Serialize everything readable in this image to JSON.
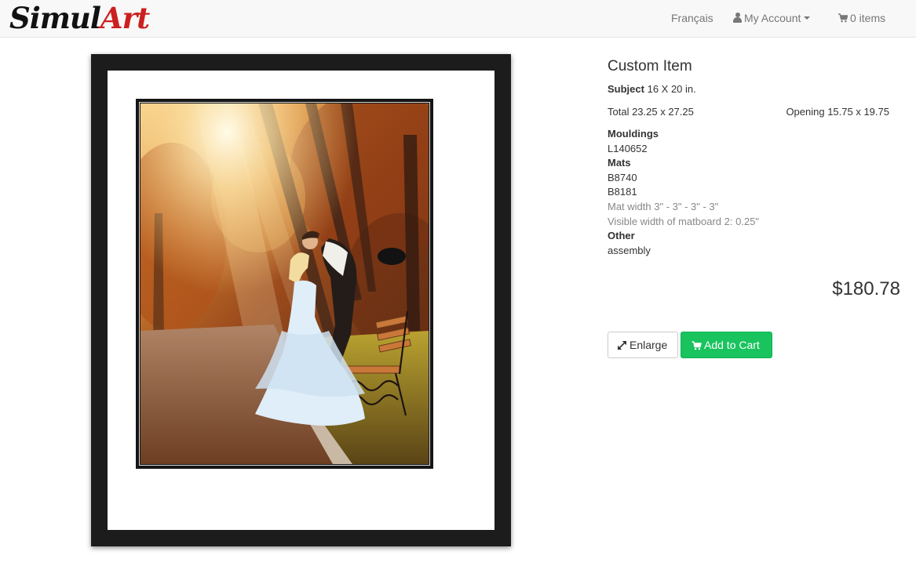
{
  "navbar": {
    "logo_part1": "Simul",
    "logo_part2": "Art",
    "language": "Français",
    "account": "My Account",
    "cart": "0 items"
  },
  "product": {
    "title": "Custom Item",
    "subject_label": "Subject",
    "subject_value": "16 X 20 in.",
    "total": "Total 23.25 x 27.25",
    "opening": "Opening 15.75 x 19.75",
    "mouldings_label": "Mouldings",
    "mouldings": [
      "L140652"
    ],
    "mats_label": "Mats",
    "mats": [
      "B8740",
      "B8181"
    ],
    "mat_width": "Mat width 3\" - 3\" - 3\" - 3\"",
    "visible_width": "Visible width of matboard 2: 0.25\"",
    "other_label": "Other",
    "other": [
      "assembly"
    ],
    "price": "$180.78"
  },
  "buttons": {
    "enlarge": "Enlarge",
    "add_to_cart": "Add to Cart"
  },
  "icons": {
    "account": "user-icon",
    "dropdown": "caret-down-icon",
    "cart": "shopping-cart-icon",
    "enlarge": "expand-icon"
  },
  "colors": {
    "brand_red": "#cc1f1f",
    "add_to_cart_green": "#19c35e",
    "frame": "#1c1c1c",
    "mat": "#ffffff"
  }
}
